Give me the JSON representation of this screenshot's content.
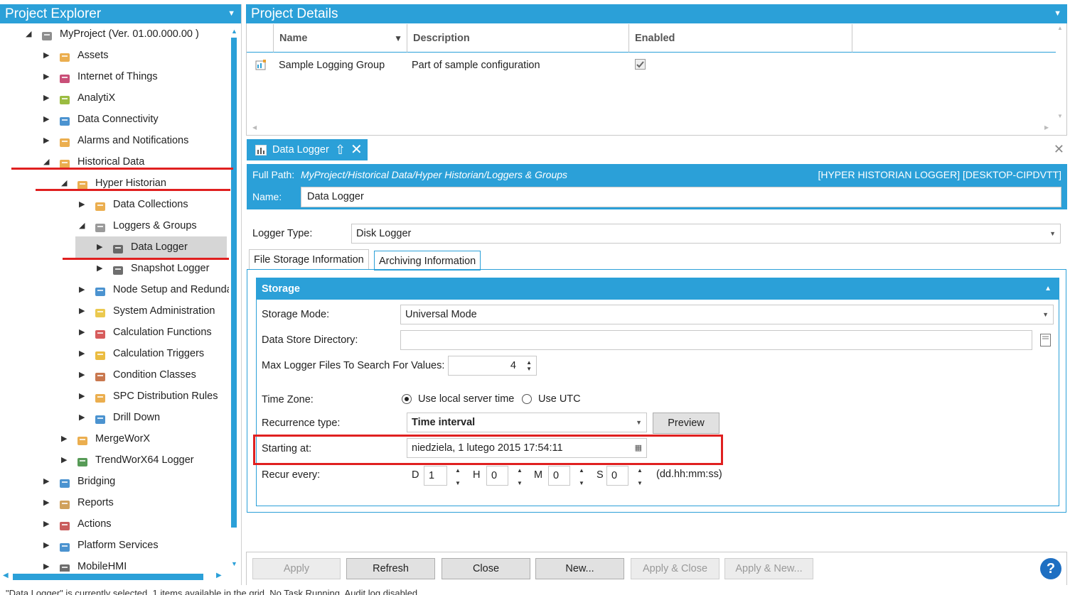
{
  "explorer": {
    "title": "Project Explorer",
    "items": [
      {
        "label": "MyProject  (Ver. 01.00.000.00 )",
        "icon": "project-icon",
        "arrow": "expanded"
      },
      {
        "label": "Assets",
        "icon": "assets-icon",
        "arrow": "collapsed"
      },
      {
        "label": "Internet of Things",
        "icon": "iot-icon",
        "arrow": "collapsed"
      },
      {
        "label": "AnalytiX",
        "icon": "analytix-icon",
        "arrow": "collapsed"
      },
      {
        "label": "Data Connectivity",
        "icon": "gears-icon",
        "arrow": "collapsed"
      },
      {
        "label": "Alarms and Notifications",
        "icon": "bell-icon",
        "arrow": "collapsed"
      },
      {
        "label": "Historical Data",
        "icon": "historical-icon",
        "arrow": "expanded"
      },
      {
        "label": "Hyper Historian",
        "icon": "historian-icon",
        "arrow": "expanded"
      },
      {
        "label": "Data Collections",
        "icon": "collections-icon",
        "arrow": "collapsed"
      },
      {
        "label": "Loggers & Groups",
        "icon": "loggers-icon",
        "arrow": "expanded"
      },
      {
        "label": "Data Logger",
        "icon": "chart-icon",
        "arrow": "collapsed"
      },
      {
        "label": "Snapshot Logger",
        "icon": "chart-icon",
        "arrow": "collapsed"
      },
      {
        "label": "Node Setup and Redundanc",
        "icon": "node-icon",
        "arrow": "collapsed"
      },
      {
        "label": "System Administration",
        "icon": "doc-icon",
        "arrow": "collapsed"
      },
      {
        "label": "Calculation Functions",
        "icon": "function-icon",
        "arrow": "collapsed"
      },
      {
        "label": "Calculation Triggers",
        "icon": "lightning-icon",
        "arrow": "collapsed"
      },
      {
        "label": "Condition Classes",
        "icon": "condition-icon",
        "arrow": "collapsed"
      },
      {
        "label": "SPC Distribution Rules",
        "icon": "spc-icon",
        "arrow": "collapsed"
      },
      {
        "label": "Drill Down",
        "icon": "drill-icon",
        "arrow": "collapsed"
      },
      {
        "label": "MergeWorX",
        "icon": "merge-icon",
        "arrow": "collapsed"
      },
      {
        "label": "TrendWorX64 Logger",
        "icon": "trend-icon",
        "arrow": "collapsed"
      },
      {
        "label": "Bridging",
        "icon": "bridging-icon",
        "arrow": "collapsed"
      },
      {
        "label": "Reports",
        "icon": "reports-icon",
        "arrow": "collapsed"
      },
      {
        "label": "Actions",
        "icon": "actions-icon",
        "arrow": "collapsed"
      },
      {
        "label": "Platform Services",
        "icon": "monitor-icon",
        "arrow": "collapsed"
      },
      {
        "label": "MobileHMI",
        "icon": "mobile-icon",
        "arrow": "collapsed"
      }
    ]
  },
  "details": {
    "title": "Project Details",
    "columns": [
      "Name",
      "Description",
      "Enabled"
    ],
    "row": {
      "name": "Sample Logging Group",
      "description": "Part of sample configuration",
      "enabled": true
    }
  },
  "logger": {
    "tab_label": "Data Logger",
    "full_path_label": "Full Path:",
    "full_path": "MyProject/Historical Data/Hyper Historian/Loggers & Groups",
    "node_info": "[HYPER HISTORIAN LOGGER] [DESKTOP-CIPDVTT]",
    "name_label": "Name:",
    "name_value": "Data Logger",
    "logger_type_label": "Logger Type:",
    "logger_type": "Disk Logger",
    "tabs": [
      "File Storage Information",
      "Archiving Information"
    ],
    "storage": {
      "title": "Storage",
      "storage_mode_label": "Storage Mode:",
      "storage_mode": "Universal Mode",
      "data_store_label": "Data Store Directory:",
      "data_store": "",
      "max_files_label": "Max Logger Files To Search For Values:",
      "max_files": "4",
      "time_zone_label": "Time Zone:",
      "tz_local": "Use local server time",
      "tz_utc": "Use UTC",
      "recurrence_label": "Recurrence type:",
      "recurrence": "Time interval",
      "preview": "Preview",
      "starting_label": "Starting at:",
      "starting": "niedziela, 1 lutego 2015 17:54:11",
      "recur_label": "Recur every:",
      "d_label": "D",
      "d": "1",
      "h_label": "H",
      "h": "0",
      "m_label": "M",
      "m": "0",
      "s_label": "S",
      "s": "0",
      "format": "(dd.hh:mm:ss)"
    }
  },
  "buttons": {
    "apply": "Apply",
    "refresh": "Refresh",
    "close": "Close",
    "new": "New...",
    "apply_close": "Apply & Close",
    "apply_new": "Apply & New..."
  },
  "status": "\"Data Logger\" is currently selected.   1 items available in the grid.   No Task Running.   Audit log disabled.",
  "colors": {
    "accent": "#2ba0d8",
    "annotation": "#e02020"
  }
}
